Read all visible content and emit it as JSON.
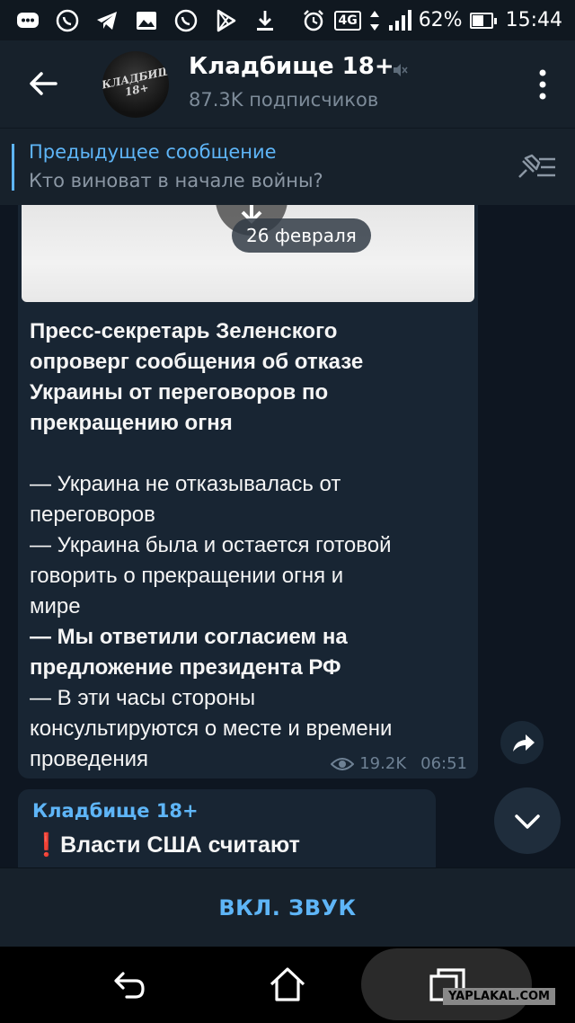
{
  "status_bar": {
    "battery": "62%",
    "battery_level": 0.62,
    "time": "15:44",
    "network": "4G"
  },
  "header": {
    "title": "Кладбище 18+",
    "subtitle": "87.3K подписчиков",
    "avatar_text": "КЛАДБИЩЕ 18+"
  },
  "pinned": {
    "title": "Предыдущее сообщение",
    "text": "Кто виноват в начале войны?"
  },
  "message": {
    "date": "26 февраля",
    "headline": [
      "Пресс-секретарь Зеленского",
      "опроверг сообщения об отказе",
      "Украины от переговоров по",
      "прекращению огня"
    ],
    "lines": [
      {
        "text": "— Украина не отказывалась от",
        "bold": false
      },
      {
        "text": "переговоров",
        "bold": false
      },
      {
        "text": "— Украина была и остается готовой",
        "bold": false
      },
      {
        "text": "говорить о прекращении огня и",
        "bold": false
      },
      {
        "text": "мире",
        "bold": false
      },
      {
        "text": "— Мы ответили согласием на",
        "bold": true
      },
      {
        "text": "предложение президента РФ",
        "bold": true
      },
      {
        "text": "— В эти часы стороны",
        "bold": false
      },
      {
        "text": "консультируются о месте и времени",
        "bold": false
      },
      {
        "text": "проведения",
        "bold": false
      }
    ],
    "views": "19.2K",
    "time": "06:51"
  },
  "next_message": {
    "author": "Кладбище 18+",
    "emoji": "❗",
    "text": "Власти США считают"
  },
  "bottom_bar": {
    "unmute_label": "ВКЛ. ЗВУК"
  },
  "watermark": "YAPLAKAL.COM",
  "colors": {
    "accent": "#5eb5f7",
    "background": "#0e1621",
    "header": "#17212b",
    "bubble": "#182533"
  }
}
